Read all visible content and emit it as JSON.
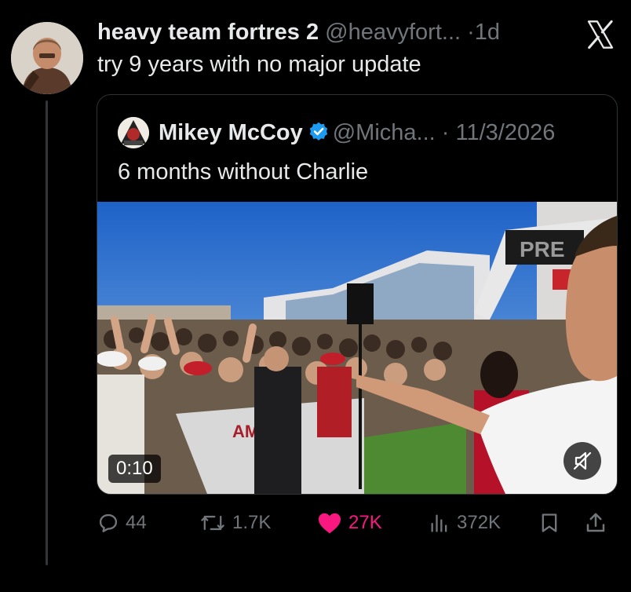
{
  "post": {
    "display_name": "heavy team fortres 2",
    "handle": "@heavyfort...",
    "separator": "·",
    "time": "1d",
    "text": "try 9 years with no major update"
  },
  "quoted": {
    "display_name": "Mikey McCoy",
    "handle": "@Micha...",
    "separator": "·",
    "date": "11/3/2026",
    "text": "6 months without Charlie",
    "video": {
      "duration": "0:10",
      "sign_text": "PRE",
      "banner_text": "AME"
    }
  },
  "actions": {
    "replies": "44",
    "reposts": "1.7K",
    "likes": "27K",
    "views": "372K"
  },
  "colors": {
    "like": "#f91880",
    "verified": "#1d9bf0",
    "muted_text": "#71767b",
    "border": "#2f3336"
  },
  "icons": [
    "x-logo-icon",
    "verified-badge-icon",
    "reply-icon",
    "repost-icon",
    "heart-icon",
    "views-icon",
    "bookmark-icon",
    "share-icon",
    "mute-icon"
  ]
}
